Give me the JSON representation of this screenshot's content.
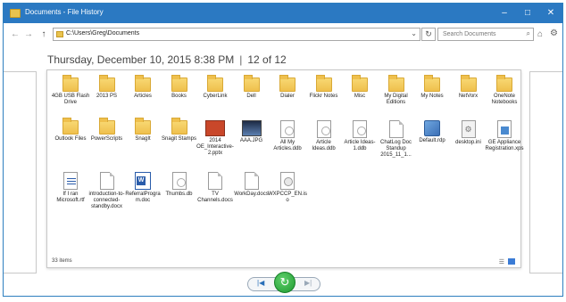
{
  "window": {
    "title": "Documents - File History",
    "minimize": "–",
    "maximize": "□",
    "close": "✕"
  },
  "nav": {
    "back": "←",
    "forward": "→",
    "up": "↑",
    "address": "C:\\Users\\Greg\\Documents",
    "address_dropdown": "⌄",
    "refresh": "↻",
    "search_placeholder": "Search Documents",
    "search_icon": "⌕",
    "home_icon": "⌂",
    "settings_icon": "⚙"
  },
  "header": {
    "date": "Thursday, December 10, 2015 8:38 PM",
    "separator": "|",
    "position": "12 of 12"
  },
  "items": [
    {
      "label": "4GB USB Flash Drive",
      "icon": "folder"
    },
    {
      "label": "2013 PS",
      "icon": "folder"
    },
    {
      "label": "Articles",
      "icon": "folder"
    },
    {
      "label": "Books",
      "icon": "folder"
    },
    {
      "label": "CyberLink",
      "icon": "folder"
    },
    {
      "label": "Dell",
      "icon": "folder"
    },
    {
      "label": "Dialer",
      "icon": "folder"
    },
    {
      "label": "Flickr Notes",
      "icon": "folder"
    },
    {
      "label": "Misc",
      "icon": "folder"
    },
    {
      "label": "My Digital Editions",
      "icon": "folder"
    },
    {
      "label": "My Notes",
      "icon": "folder"
    },
    {
      "label": "NetVorx",
      "icon": "folder"
    },
    {
      "label": "OneNote Notebooks",
      "icon": "folder"
    },
    {
      "label": "Outlook Files",
      "icon": "folder"
    },
    {
      "label": "PowerScripts",
      "icon": "folder"
    },
    {
      "label": "SnagIt",
      "icon": "folder"
    },
    {
      "label": "Snagit Stamps",
      "icon": "folder"
    },
    {
      "label": "2014 OE_Interactive-2.pptx",
      "icon": "ppt"
    },
    {
      "label": "AAA.JPG",
      "icon": "image"
    },
    {
      "label": "All My Articles.ddb",
      "icon": "db"
    },
    {
      "label": "Article Ideas.ddb",
      "icon": "db"
    },
    {
      "label": "Article Ideas-1.ddb",
      "icon": "db"
    },
    {
      "label": "ChatLog Doc Standup 2015_11_1...",
      "icon": "doc"
    },
    {
      "label": "Default.rdp",
      "icon": "rdp"
    },
    {
      "label": "desktop.ini",
      "icon": "ini"
    },
    {
      "label": "GE Appliance Registration.xps",
      "icon": "xps"
    },
    {
      "label": "If I ran Microsoft.rtf",
      "icon": "rtf"
    },
    {
      "label": "introduction-to-connected-standby.docx",
      "icon": "doc"
    },
    {
      "label": "ReferralProgram.doc",
      "icon": "word"
    },
    {
      "label": "Thumbs.db",
      "icon": "db"
    },
    {
      "label": "TV Channels.docs",
      "icon": "doc"
    },
    {
      "label": "WorkDay.docs",
      "icon": "doc"
    },
    {
      "label": "WXPCCP_EN.iso",
      "icon": "iso"
    }
  ],
  "status": {
    "count": "33 items",
    "details_view_icon": "details-view-icon",
    "large_icons_view_icon": "large-icons-view-icon"
  },
  "playback": {
    "previous": "|◀",
    "restore": "↻",
    "next": "▶|"
  },
  "colors": {
    "titlebar": "#2b79c2",
    "folder": "#efc04d",
    "restore_green": "#1f9a31"
  }
}
